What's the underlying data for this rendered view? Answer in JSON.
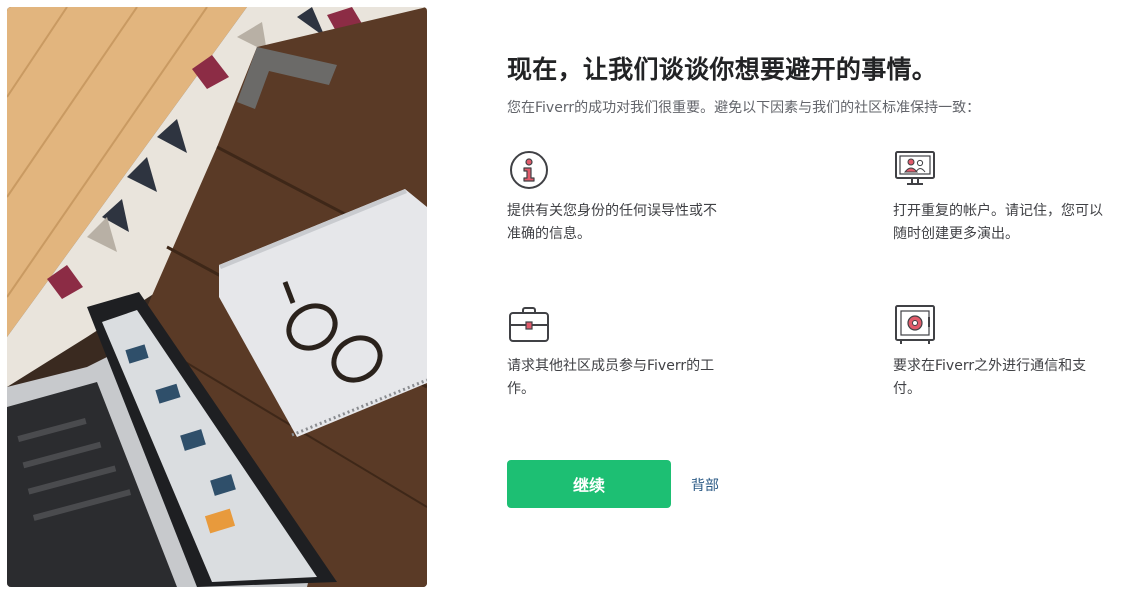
{
  "page": {
    "title": "现在，让我们谈谈你想要避开的事情。",
    "subtitle": "您在Fiverr的成功对我们很重要。避免以下因素与我们的社区标准保持一致："
  },
  "items": [
    {
      "icon": "info-icon",
      "text": "提供有关您身份的任何误导性或不准确的信息。"
    },
    {
      "icon": "monitor-users-icon",
      "text": "打开重复的帐户。请记住，您可以随时创建更多演出。"
    },
    {
      "icon": "briefcase-icon",
      "text": "请求其他社区成员参与Fiverr的工作。"
    },
    {
      "icon": "safe-icon",
      "text": "要求在Fiverr之外进行通信和支付。"
    }
  ],
  "actions": {
    "continue_label": "继续",
    "back_label": "背部"
  },
  "colors": {
    "primary": "#1dbf73",
    "link": "#2b5a85",
    "icon_accent": "#e05a6a"
  }
}
